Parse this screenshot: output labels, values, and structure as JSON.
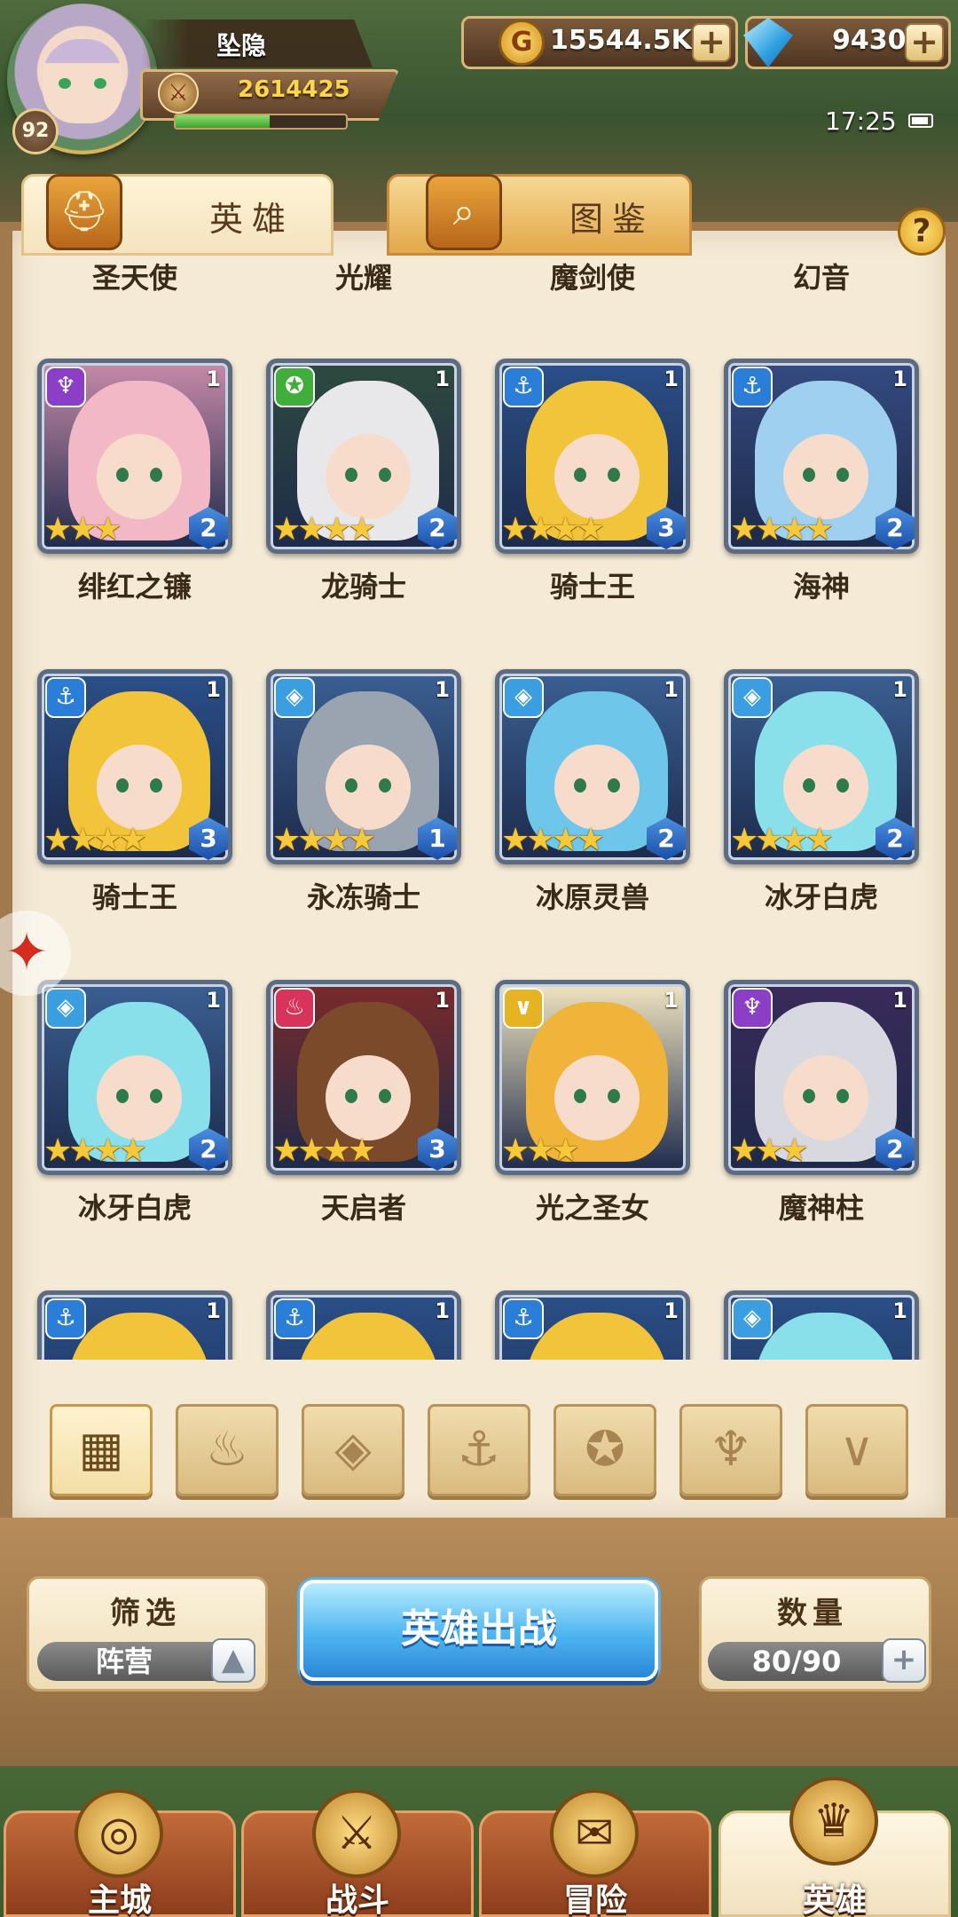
{
  "player": {
    "name": "坠隐",
    "level": "92",
    "power": "2614425",
    "xp_fraction": 0.55
  },
  "resources": {
    "gold": "15544.5K",
    "gems": "9430"
  },
  "status": {
    "time": "17:25"
  },
  "tabs": [
    {
      "label": "英雄",
      "active": true,
      "icon": "helmet-icon"
    },
    {
      "label": "图鉴",
      "active": false,
      "icon": "magnifier-icon"
    }
  ],
  "help_label": "?",
  "top_row_names": [
    "圣天使",
    "光耀",
    "魔剑使",
    "幻音"
  ],
  "heroes": [
    {
      "name": "绯红之镰",
      "count": "1",
      "stars": 3,
      "level": "2",
      "faction": "demon",
      "faction_color": "#8a3fc6",
      "bg": "#c68aa8",
      "hair": "#f2b8c6"
    },
    {
      "name": "龙骑士",
      "count": "1",
      "stars": 4,
      "level": "2",
      "faction": "beast",
      "faction_color": "#3fae3a",
      "bg": "#2e4a3e",
      "hair": "#e8e8ea"
    },
    {
      "name": "骑士王",
      "count": "1",
      "stars": 4,
      "level": "3",
      "faction": "anchor",
      "faction_color": "#2a7ed8",
      "bg": "#2a4f88",
      "hair": "#f2c43a"
    },
    {
      "name": "海神",
      "count": "1",
      "stars": 4,
      "level": "2",
      "faction": "anchor",
      "faction_color": "#2a7ed8",
      "bg": "#344a80",
      "hair": "#9fd0f0"
    },
    {
      "name": "骑士王",
      "count": "1",
      "stars": 4,
      "level": "3",
      "faction": "anchor",
      "faction_color": "#2a7ed8",
      "bg": "#2a4f88",
      "hair": "#f2c43a"
    },
    {
      "name": "永冻骑士",
      "count": "1",
      "stars": 4,
      "level": "1",
      "faction": "ice",
      "faction_color": "#3a9ee0",
      "bg": "#3a5f92",
      "hair": "#9aa3b0"
    },
    {
      "name": "冰原灵兽",
      "count": "1",
      "stars": 4,
      "level": "2",
      "faction": "ice",
      "faction_color": "#3a9ee0",
      "bg": "#3a5f92",
      "hair": "#6ec6ea"
    },
    {
      "name": "冰牙白虎",
      "count": "1",
      "stars": 4,
      "level": "2",
      "faction": "ice",
      "faction_color": "#3a9ee0",
      "bg": "#3a5f92",
      "hair": "#8ae0ea"
    },
    {
      "name": "冰牙白虎",
      "count": "1",
      "stars": 4,
      "level": "2",
      "faction": "ice",
      "faction_color": "#3a9ee0",
      "bg": "#3a5f92",
      "hair": "#8ae0ea"
    },
    {
      "name": "天启者",
      "count": "1",
      "stars": 4,
      "level": "3",
      "faction": "flame",
      "faction_color": "#d8335a",
      "bg": "#7a2a2a",
      "hair": "#7a4a2a"
    },
    {
      "name": "光之圣女",
      "count": "1",
      "stars": 3,
      "level": "",
      "faction": "light",
      "faction_color": "#e6b422",
      "bg": "#f0e4c0",
      "hair": "#f0b43a"
    },
    {
      "name": "魔神柱",
      "count": "1",
      "stars": 3,
      "level": "2",
      "faction": "demon",
      "faction_color": "#8a3fc6",
      "bg": "#3a2a5a",
      "hair": "#d8d8e0"
    }
  ],
  "partial_row": [
    {
      "faction": "anchor",
      "faction_color": "#2a7ed8",
      "count": "1",
      "hair": "#f2c43a"
    },
    {
      "faction": "anchor",
      "faction_color": "#2a7ed8",
      "count": "1",
      "hair": "#f2c43a"
    },
    {
      "faction": "anchor",
      "faction_color": "#2a7ed8",
      "count": "1",
      "hair": "#f2c43a"
    },
    {
      "faction": "ice",
      "faction_color": "#3a9ee0",
      "count": "1",
      "hair": "#8ae0ea"
    }
  ],
  "faction_filters": [
    {
      "name": "all",
      "icon": "grid-icon",
      "active": true
    },
    {
      "name": "flame",
      "icon": "flame-icon",
      "active": false
    },
    {
      "name": "ice",
      "icon": "ice-crystal-icon",
      "active": false
    },
    {
      "name": "anchor",
      "icon": "anchor-icon",
      "active": false
    },
    {
      "name": "beast",
      "icon": "beast-icon",
      "active": false
    },
    {
      "name": "demon",
      "icon": "demon-horn-icon",
      "active": false
    },
    {
      "name": "light",
      "icon": "wing-icon",
      "active": false
    }
  ],
  "filter_box": {
    "title": "筛选",
    "value": "阵营"
  },
  "deploy_button": "英雄出战",
  "count_box": {
    "title": "数量",
    "value": "80/90"
  },
  "nav": [
    {
      "label": "主城",
      "icon": "city-icon",
      "active": false
    },
    {
      "label": "战斗",
      "icon": "crossed-swords-icon",
      "active": false
    },
    {
      "label": "冒险",
      "icon": "scroll-map-icon",
      "active": false
    },
    {
      "label": "英雄",
      "icon": "hero-helmet-icon",
      "active": true
    }
  ]
}
